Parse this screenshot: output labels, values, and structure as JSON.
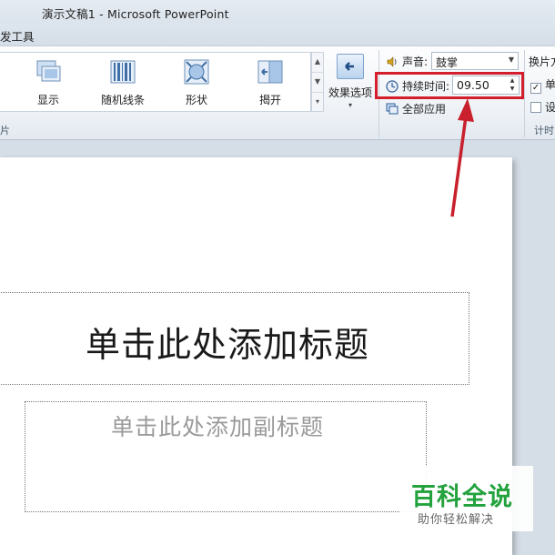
{
  "window": {
    "title": "演示文稿1 - Microsoft PowerPoint"
  },
  "menu": {
    "tab_partial": "发工具"
  },
  "ribbon": {
    "gallery": [
      {
        "label": "显示",
        "icon": "show-transition-icon"
      },
      {
        "label": "随机线条",
        "icon": "random-bars-icon"
      },
      {
        "label": "形状",
        "icon": "shape-transition-icon"
      },
      {
        "label": "揭开",
        "icon": "uncover-transition-icon"
      }
    ],
    "effect_options": {
      "label": "效果选项",
      "arrow": "▾"
    },
    "group_label_left": "片",
    "timing": {
      "sound_label": "声音:",
      "sound_value": "鼓掌",
      "duration_label": "持续时间:",
      "duration_value": "09.50",
      "apply_all": "全部应用",
      "advance_label": "换片方",
      "on_click": "单",
      "after": "设",
      "group_label": "计时"
    }
  },
  "slide": {
    "title_placeholder": "单击此处添加标题",
    "subtitle_placeholder": "单击此处添加副标题"
  },
  "watermark": {
    "brand": "百科全说",
    "tagline": "助你轻松解决"
  },
  "colors": {
    "highlight": "#d41e2c",
    "watermark_green": "#23a23d"
  }
}
